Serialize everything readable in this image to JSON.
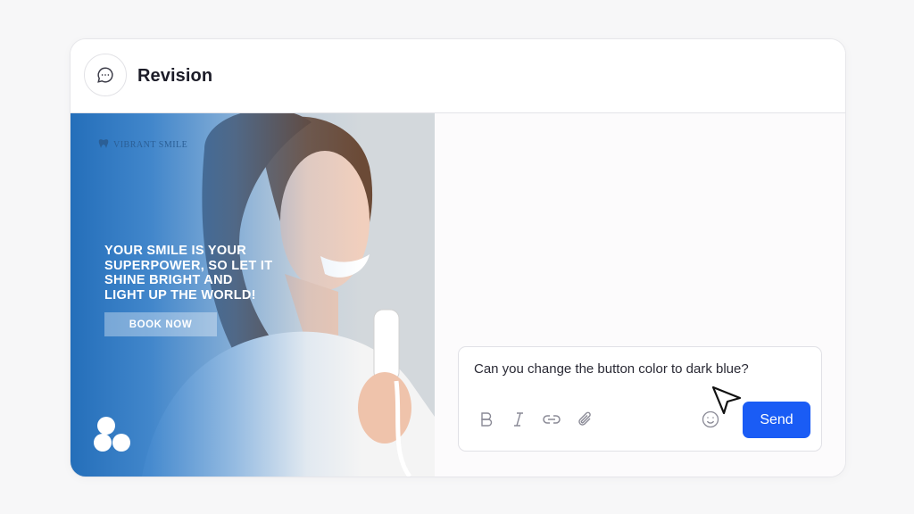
{
  "header": {
    "title": "Revision",
    "icon": "chat-bubble-icon"
  },
  "ad": {
    "brand_name": "VIBRANT SMILE",
    "headline_lines": [
      "YOUR SMILE IS YOUR",
      "SUPERPOWER, SO LET IT",
      "SHINE BRIGHT AND",
      "LIGHT UP THE WORLD!"
    ],
    "cta_label": "BOOK NOW",
    "logo_icon": "clover-logo-icon"
  },
  "composer": {
    "message": "Can you change the button color to dark blue?",
    "tools": [
      "bold-icon",
      "italic-icon",
      "link-icon",
      "attachment-icon",
      "emoji-icon"
    ],
    "send_label": "Send"
  },
  "colors": {
    "send_button": "#1a5cf5",
    "ad_blue": "#1b69b8"
  }
}
